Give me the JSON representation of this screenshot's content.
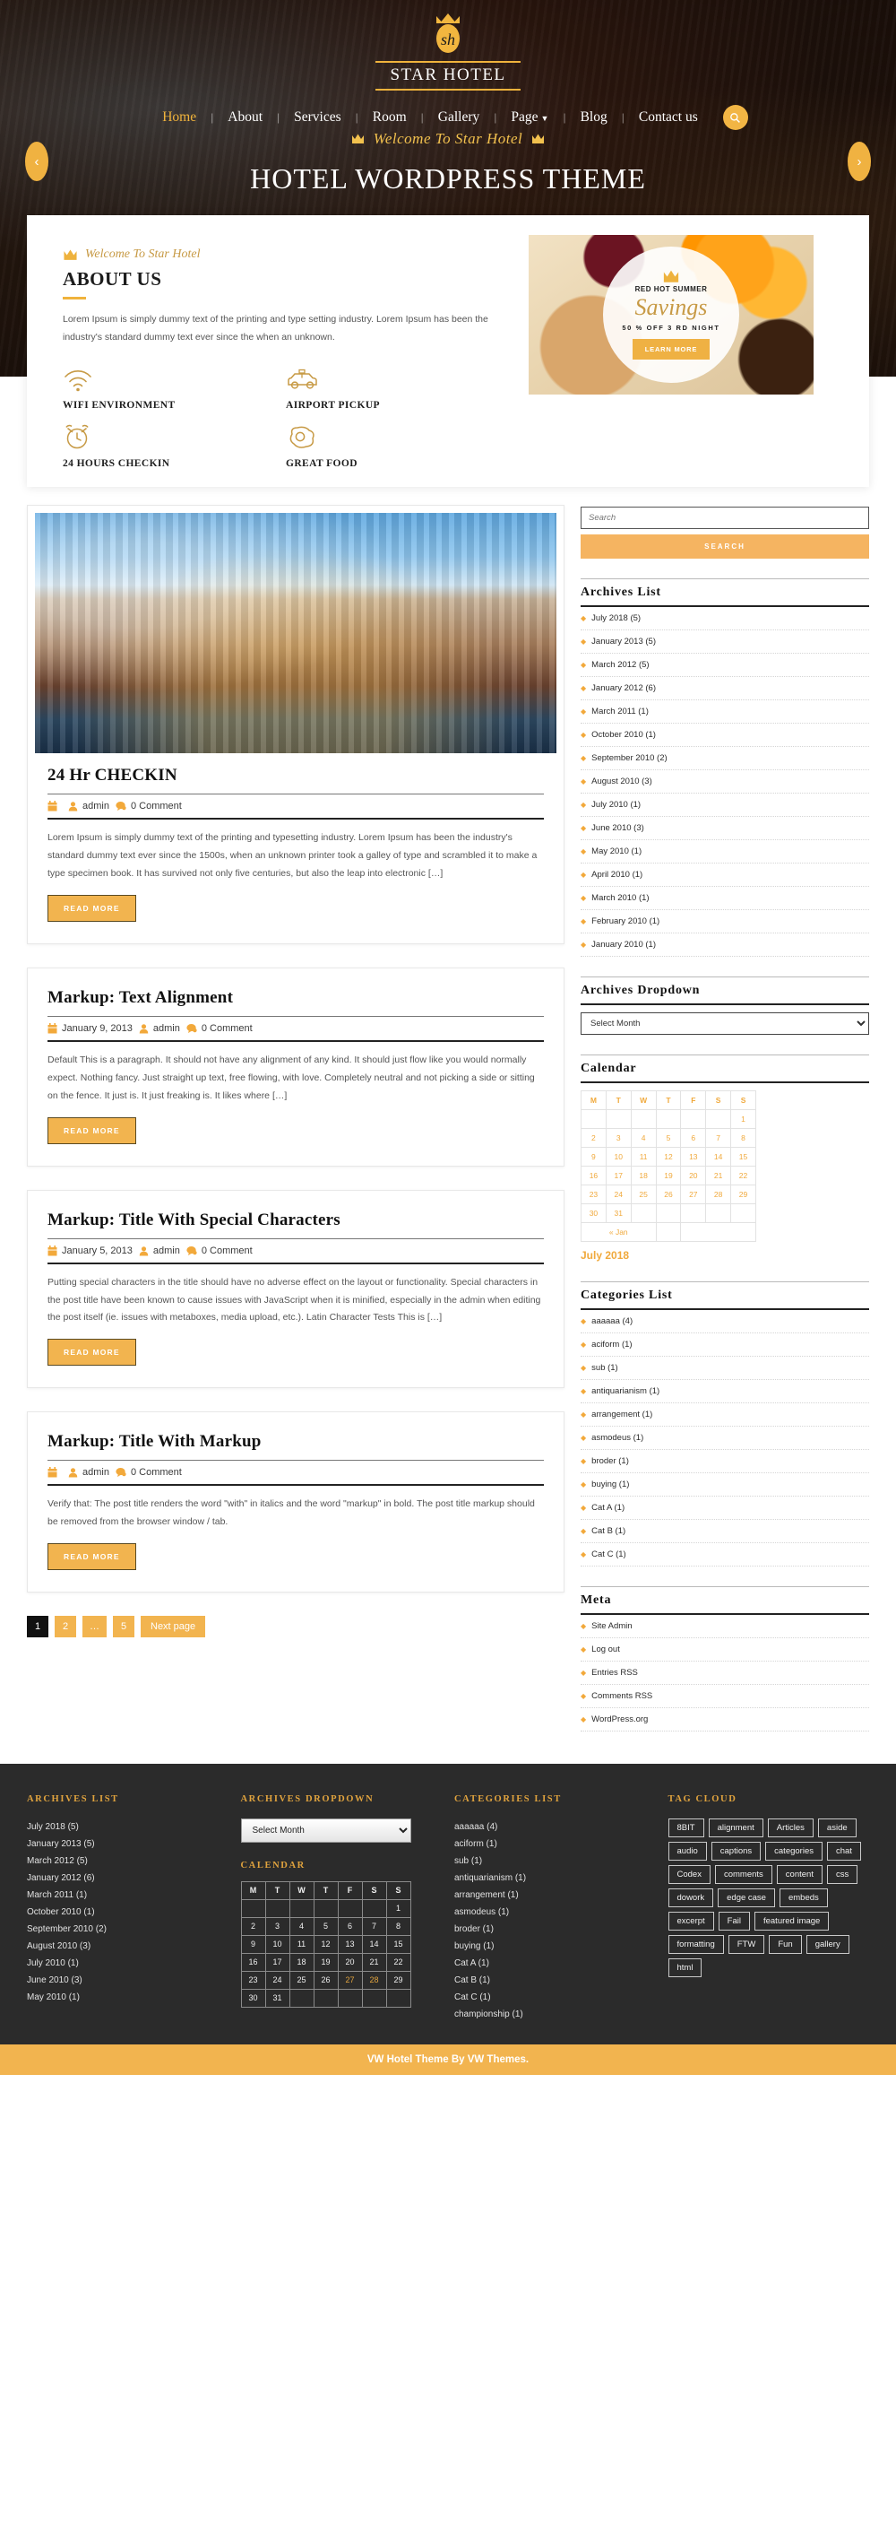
{
  "brand": {
    "name": "STAR HOTEL",
    "logo_icon": "crown-sh-logo"
  },
  "nav": {
    "items": [
      {
        "label": "Home",
        "active": true
      },
      {
        "label": "About",
        "active": false
      },
      {
        "label": "Services",
        "active": false
      },
      {
        "label": "Room",
        "active": false
      },
      {
        "label": "Gallery",
        "active": false
      },
      {
        "label": "Page",
        "active": false,
        "has_dropdown": true
      },
      {
        "label": "Blog",
        "active": false
      },
      {
        "label": "Contact us",
        "active": false
      }
    ],
    "search_icon": "search-icon"
  },
  "hero": {
    "kicker": "Welcome To Star Hotel",
    "title": "HOTEL WORDPRESS THEME",
    "prev_icon": "chevron-left-icon",
    "next_icon": "chevron-right-icon"
  },
  "about": {
    "kicker": "Welcome To Star Hotel",
    "title": "ABOUT US",
    "text": "Lorem Ipsum is simply dummy text of the printing and type setting industry. Lorem Ipsum has been the industry's standard dummy text ever since the when an unknown.",
    "features": [
      {
        "icon": "wifi-icon",
        "label": "WIFI ENVIRONMENT"
      },
      {
        "icon": "car-icon",
        "label": "AIRPORT PICKUP"
      },
      {
        "icon": "alarm-clock-icon",
        "label": "24 HOURS CHECKIN"
      },
      {
        "icon": "fried-egg-icon",
        "label": "GREAT FOOD"
      }
    ],
    "promo": {
      "crown_icon": "crown-icon",
      "kicker": "RED HOT SUMMER",
      "script": "Savings",
      "offer": "50 % OFF 3 RD NIGHT",
      "button": "LEARN MORE"
    }
  },
  "posts": [
    {
      "has_thumb": true,
      "title": "24 Hr CHECKIN",
      "date": "",
      "author": "admin",
      "comments": "0 Comment",
      "excerpt": "Lorem Ipsum is simply dummy text of the printing and typesetting industry. Lorem Ipsum has been the industry's standard dummy text ever since the 1500s, when an unknown printer took a galley of type and scrambled it to make a type specimen book. It has survived not only five centuries, but also the leap into electronic […]",
      "read_more": "READ MORE"
    },
    {
      "has_thumb": false,
      "title": "Markup: Text Alignment",
      "date": "January 9, 2013",
      "author": "admin",
      "comments": "0 Comment",
      "excerpt": "Default This is a paragraph. It should not have any alignment of any kind. It should just flow like you would normally expect. Nothing fancy. Just straight up text, free flowing, with love. Completely neutral and not picking a side or sitting on the fence. It just is. It just freaking is. It likes where […]",
      "read_more": "READ MORE"
    },
    {
      "has_thumb": false,
      "title": "Markup: Title With Special Characters",
      "date": "January 5, 2013",
      "author": "admin",
      "comments": "0 Comment",
      "excerpt": "Putting special characters in the title should have no adverse effect on the layout or functionality. Special characters in the post title have been known to cause issues with JavaScript when it is minified, especially in the admin when editing the post itself (ie. issues with metaboxes, media upload, etc.). Latin Character Tests This is […]",
      "read_more": "READ MORE"
    },
    {
      "has_thumb": false,
      "title": "Markup: Title With Markup",
      "date": "",
      "author": "admin",
      "comments": "0 Comment",
      "excerpt": "Verify that: The post title renders the word \"with\" in italics and the word \"markup\" in bold. The post title markup should be removed from the browser window / tab.",
      "read_more": "READ MORE"
    }
  ],
  "pagination": [
    {
      "label": "1",
      "current": true
    },
    {
      "label": "2",
      "current": false
    },
    {
      "label": "…",
      "current": false
    },
    {
      "label": "5",
      "current": false
    },
    {
      "label": "Next page",
      "current": false
    }
  ],
  "sidebar": {
    "search": {
      "placeholder": "Search",
      "button": "SEARCH"
    },
    "archives": {
      "title": "Archives List",
      "items": [
        "July 2018 (5)",
        "January 2013 (5)",
        "March 2012 (5)",
        "January 2012 (6)",
        "March 2011 (1)",
        "October 2010 (1)",
        "September 2010 (2)",
        "August 2010 (3)",
        "July 2010 (1)",
        "June 2010 (3)",
        "May 2010 (1)",
        "April 2010 (1)",
        "March 2010 (1)",
        "February 2010 (1)",
        "January 2010 (1)"
      ]
    },
    "archives_dropdown": {
      "title": "Archives Dropdown",
      "selected": "Select Month"
    },
    "calendar": {
      "title": "Calendar",
      "weekdays": [
        "M",
        "T",
        "W",
        "T",
        "F",
        "S",
        "S"
      ],
      "weeks": [
        [
          "",
          "",
          "",
          "",
          "",
          "",
          "1"
        ],
        [
          "2",
          "3",
          "4",
          "5",
          "6",
          "7",
          "8"
        ],
        [
          "9",
          "10",
          "11",
          "12",
          "13",
          "14",
          "15"
        ],
        [
          "16",
          "17",
          "18",
          "19",
          "20",
          "21",
          "22"
        ],
        [
          "23",
          "24",
          "25",
          "26",
          "27",
          "28",
          "29"
        ],
        [
          "30",
          "31",
          "",
          "",
          "",
          "",
          ""
        ]
      ],
      "prev_link": "« Jan",
      "month_label": "July 2018"
    },
    "categories": {
      "title": "Categories List",
      "items": [
        "aaaaaa (4)",
        "aciform (1)",
        "sub (1)",
        "antiquarianism (1)",
        "arrangement (1)",
        "asmodeus (1)",
        "broder (1)",
        "buying (1)",
        "Cat A (1)",
        "Cat B (1)",
        "Cat C (1)"
      ]
    },
    "meta": {
      "title": "Meta",
      "items": [
        "Site Admin",
        "Log out",
        "Entries RSS",
        "Comments RSS",
        "WordPress.org"
      ]
    }
  },
  "footer": {
    "archives": {
      "title": "ARCHIVES LIST",
      "items": [
        "July 2018 (5)",
        "January 2013 (5)",
        "March 2012 (5)",
        "January 2012 (6)",
        "March 2011 (1)",
        "October 2010 (1)",
        "September 2010 (2)",
        "August 2010 (3)",
        "July 2010 (1)",
        "June 2010 (3)",
        "May 2010 (1)"
      ]
    },
    "archives_dropdown": {
      "title": "ARCHIVES DROPDOWN",
      "selected": "Select Month"
    },
    "calendar": {
      "title": "CALENDAR",
      "weekdays": [
        "M",
        "T",
        "W",
        "T",
        "F",
        "S",
        "S"
      ],
      "weeks": [
        [
          "",
          "",
          "",
          "",
          "",
          "",
          "1"
        ],
        [
          "2",
          "3",
          "4",
          "5",
          "6",
          "7",
          "8"
        ],
        [
          "9",
          "10",
          "11",
          "12",
          "13",
          "14",
          "15"
        ],
        [
          "16",
          "17",
          "18",
          "19",
          "20",
          "21",
          "22"
        ],
        [
          "23",
          "24",
          "25",
          "26",
          "27",
          "28",
          "29"
        ],
        [
          "30",
          "31",
          "",
          "",
          "",
          "",
          ""
        ]
      ],
      "highlight": [
        "27",
        "28"
      ]
    },
    "categories": {
      "title": "CATEGORIES LIST",
      "items": [
        "aaaaaa (4)",
        "aciform (1)",
        "sub (1)",
        "antiquarianism (1)",
        "arrangement (1)",
        "asmodeus (1)",
        "broder (1)",
        "buying (1)",
        "Cat A (1)",
        "Cat B (1)",
        "Cat C (1)",
        "championship (1)"
      ]
    },
    "tag_cloud": {
      "title": "TAG CLOUD",
      "tags": [
        "8BIT",
        "alignment",
        "Articles",
        "aside",
        "audio",
        "captions",
        "categories",
        "chat",
        "Codex",
        "comments",
        "content",
        "css",
        "dowork",
        "edge case",
        "embeds",
        "excerpt",
        "Fail",
        "featured image",
        "formatting",
        "FTW",
        "Fun",
        "gallery",
        "html"
      ]
    },
    "copyright": "VW Hotel Theme By VW Themes."
  },
  "colors": {
    "accent": "#f2b44f",
    "gold": "#e0a33e",
    "dark": "#2b2b2b"
  }
}
